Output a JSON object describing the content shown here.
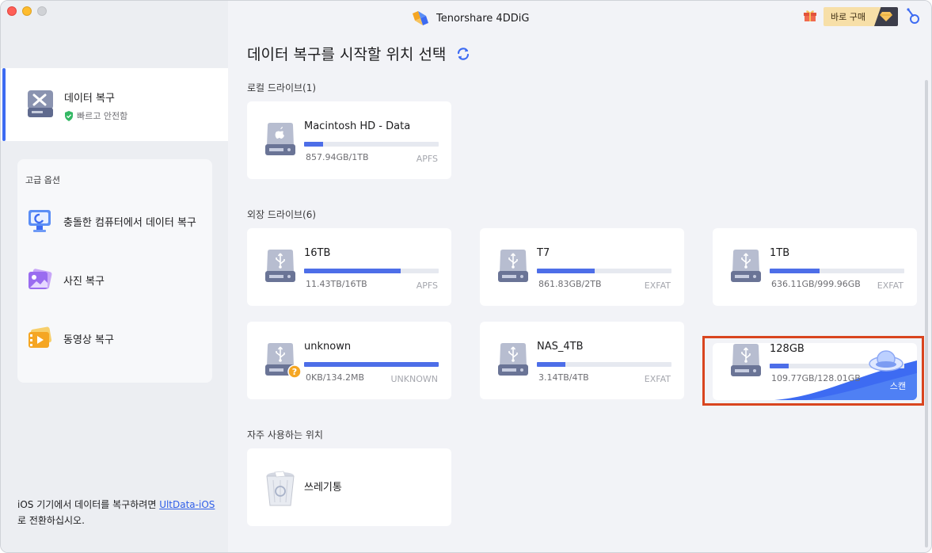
{
  "app": {
    "title": "Tenorshare 4DDiG",
    "buy_label": "바로 구매"
  },
  "sidebar": {
    "active": {
      "title": "데이터 복구",
      "subtitle": "빠르고 안전함"
    },
    "advanced_title": "고급 옵션",
    "items": [
      {
        "label": "충돌한 컴퓨터에서 데이터 복구"
      },
      {
        "label": "사진 복구"
      },
      {
        "label": "동영상 복구"
      }
    ],
    "footer": {
      "text_before": "iOS 기기에서 데이터를 복구하려면 ",
      "link": "UltData-iOS",
      "text_after": "로 전환하십시오."
    }
  },
  "main": {
    "title": "데이터 복구를 시작할 위치 선택",
    "local_label": "로컬 드라이브(1)",
    "external_label": "외장 드라이브(6)",
    "frequent_label": "자주 사용하는 위치",
    "local": [
      {
        "name": "Macintosh HD - Data",
        "size": "857.94GB/1TB",
        "fs": "APFS",
        "fill": 0.14
      }
    ],
    "external": [
      {
        "name": "16TB",
        "size": "11.43TB/16TB",
        "fs": "APFS",
        "fill": 0.72
      },
      {
        "name": "T7",
        "size": "861.83GB/2TB",
        "fs": "EXFAT",
        "fill": 0.43
      },
      {
        "name": "1TB",
        "size": "636.11GB/999.96GB",
        "fs": "EXFAT",
        "fill": 0.37
      },
      {
        "name": "unknown",
        "size": "0KB/134.2MB",
        "fs": "UNKNOWN",
        "fill": 1.0
      },
      {
        "name": "NAS_4TB",
        "size": "3.14TB/4TB",
        "fs": "EXFAT",
        "fill": 0.21
      },
      {
        "name": "128GB",
        "size": "109.77GB/128.01GB",
        "fs": "",
        "fill": 0.14,
        "scan_label": "스캔"
      }
    ],
    "frequent": [
      {
        "name": "쓰레기통"
      }
    ]
  }
}
